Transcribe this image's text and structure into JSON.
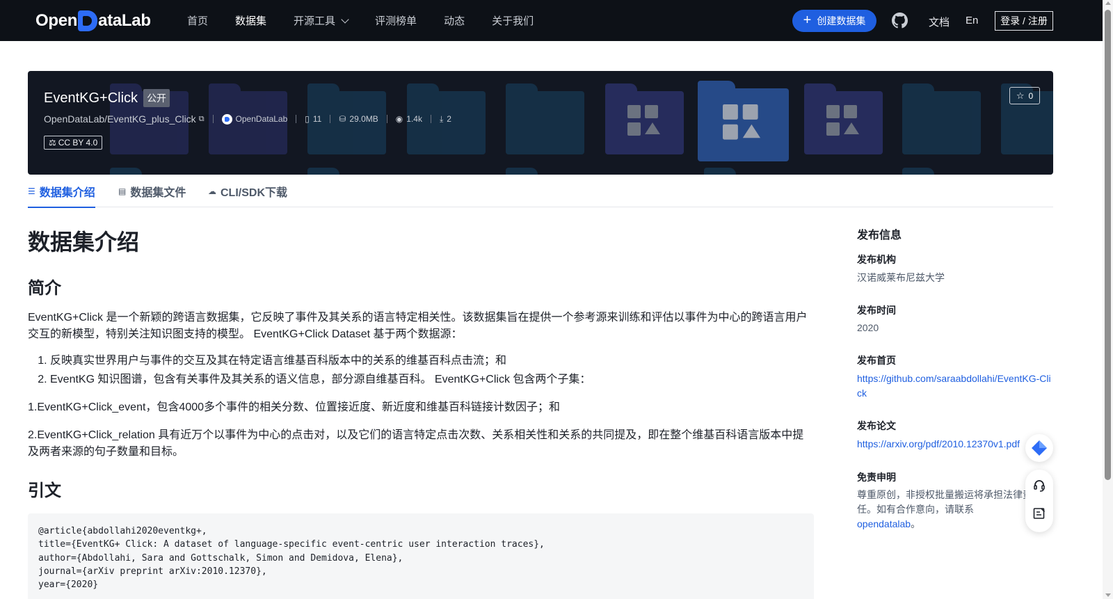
{
  "header": {
    "logo_text_left": "Open",
    "logo_text_right": "ataLab",
    "nav": [
      {
        "label": "首页"
      },
      {
        "label": "数据集"
      },
      {
        "label": "开源工具"
      },
      {
        "label": "评测榜单"
      },
      {
        "label": "动态"
      },
      {
        "label": "关于我们"
      }
    ],
    "active_nav": "数据集",
    "create_button": "创建数据集",
    "docs_link": "文档",
    "lang_link": "En",
    "login_button": "登录 / 注册",
    "icons": {
      "github": "github-icon",
      "dropdown": "chevron-down-icon",
      "plus": "plus-icon"
    }
  },
  "dataset": {
    "title": "EventKG+Click",
    "visibility": "公开",
    "repo_path": "OpenDataLab/EventKG_plus_Click",
    "org_name": "OpenDataLab",
    "file_count": "11",
    "size": "29.0MB",
    "views": "1.4k",
    "downloads": "2",
    "license": "CC BY 4.0",
    "stars": "0"
  },
  "tabs": [
    {
      "label": "数据集介绍",
      "icon": "database-icon",
      "active": true
    },
    {
      "label": "数据集文件",
      "icon": "file-icon",
      "active": false
    },
    {
      "label": "CLI/SDK下载",
      "icon": "cloud-download-icon",
      "active": false
    }
  ],
  "article": {
    "heading": "数据集介绍",
    "intro_heading": "简介",
    "intro_p1": "EventKG+Click 是一个新颖的跨语言数据集，它反映了事件及其关系的语言特定相关性。该数据集旨在提供一个参考源来训练和评估以事件为中心的跨语言用户交互的新模型，特别关注知识图支持的模型。 EventKG+Click Dataset 基于两个数据源：",
    "sources": [
      "反映真实世界用户与事件的交互及其在特定语言维基百科版本中的关系的维基百科点击流；和",
      "EventKG 知识图谱，包含有关事件及其关系的语义信息，部分源自维基百科。 EventKG+Click 包含两个子集："
    ],
    "subset_1": "1.EventKG+Click_event，包含4000多个事件的相关分数、位置接近度、新近度和维基百科链接计数因子；和",
    "subset_2": "2.EventKG+Click_relation 具有近万个以事件为中心的点击对，以及它们的语言特定点击次数、关系相关性和关系的共同提及，即在整个维基百科语言版本中提及两者来源的句子数量和目标。",
    "citation_heading": "引文",
    "citation_code": "@article{abdollahi2020eventkg+,\ntitle={EventKG+ Click: A dataset of language-specific event-centric user interaction traces},\nauthor={Abdollahi, Sara and Gottschalk, Simon and Demidova, Elena},\njournal={arXiv preprint arXiv:2010.12370},\nyear={2020}"
  },
  "sidebar": {
    "title": "发布信息",
    "org_label": "发布机构",
    "org_value": "汉诺威莱布尼兹大学",
    "time_label": "发布时间",
    "time_value": "2020",
    "homepage_label": "发布首页",
    "homepage_url": "https://github.com/saraabdollahi/EventKG-Click",
    "paper_label": "发布论文",
    "paper_url": "https://arxiv.org/pdf/2010.12370v1.pdf",
    "disclaimer_label": "免责申明",
    "disclaimer_text": "尊重原创，非授权批量搬运将承担法律责任。如有合作意向，请联系",
    "disclaimer_link": "opendatalab",
    "disclaimer_end": "。"
  },
  "colors": {
    "accent": "#1f5fe0",
    "nav_bg": "#0d1117",
    "banner_bg": "#121722"
  }
}
